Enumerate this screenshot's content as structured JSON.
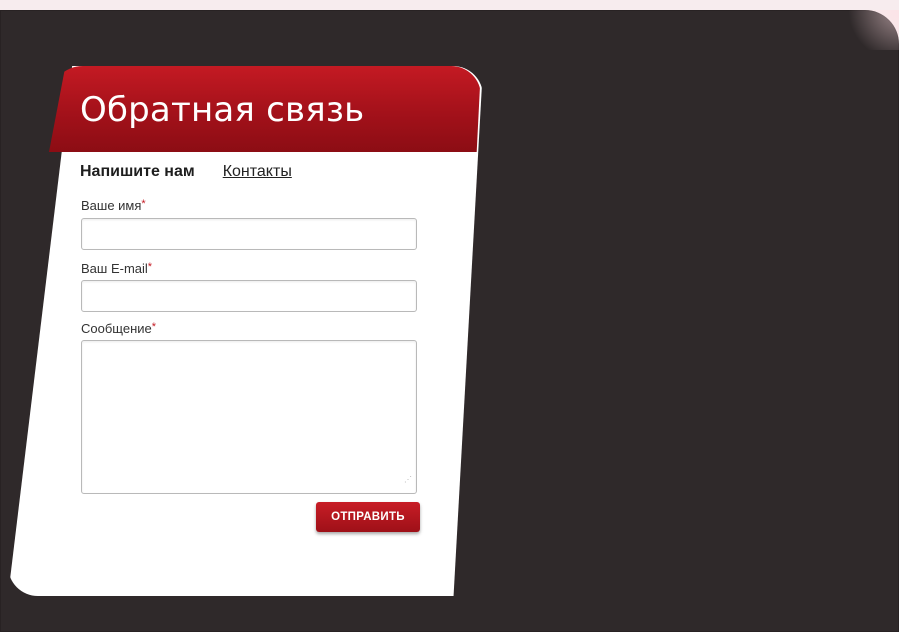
{
  "form": {
    "title": "Обратная связь",
    "tabs": {
      "write_label": "Напишите нам",
      "contacts_label": "Контакты"
    },
    "fields": {
      "name_label": "Ваше имя",
      "email_label": "Ваш E-mail",
      "message_label": "Сообщение",
      "required_mark": "*",
      "name_value": "",
      "email_value": "",
      "message_value": ""
    },
    "submit_label": "ОТПРАВИТЬ"
  },
  "colors": {
    "accent": "#b0141c",
    "background": "#2f292a",
    "card": "#ffffff"
  },
  "icons": {
    "resize": "resize-grip-icon"
  }
}
